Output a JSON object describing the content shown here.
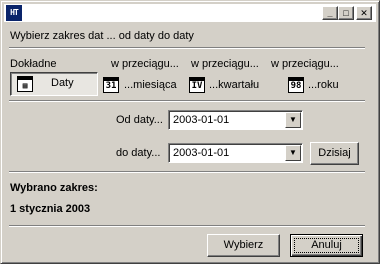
{
  "window": {
    "app_icon_text": "HT",
    "controls": {
      "minimize": "_",
      "maximize": "□",
      "close": "✕"
    }
  },
  "header": {
    "prompt": "Wybierz zakres dat ...  od daty do daty"
  },
  "sections": {
    "exact": {
      "heading": "Dokładne",
      "button_label": "Daty",
      "icon": "calendar-icon"
    },
    "month": {
      "heading": "w przeciągu...",
      "icon_text": "31",
      "label": "...miesiąca"
    },
    "quarter": {
      "heading": "w przeciągu...",
      "icon_text": "IV",
      "label": "...kwartału"
    },
    "year": {
      "heading": "w przeciągu...",
      "icon_text": "98",
      "label": "...roku"
    }
  },
  "form": {
    "from_label": "Od daty...",
    "from_value": "2003-01-01",
    "to_label": "do daty...",
    "to_value": "2003-01-01",
    "today_button": "Dzisiaj"
  },
  "summary": {
    "label": "Wybrano zakres:",
    "value": "1 stycznia 2003"
  },
  "footer": {
    "select_button": "Wybierz",
    "cancel_button": "Anuluj"
  }
}
